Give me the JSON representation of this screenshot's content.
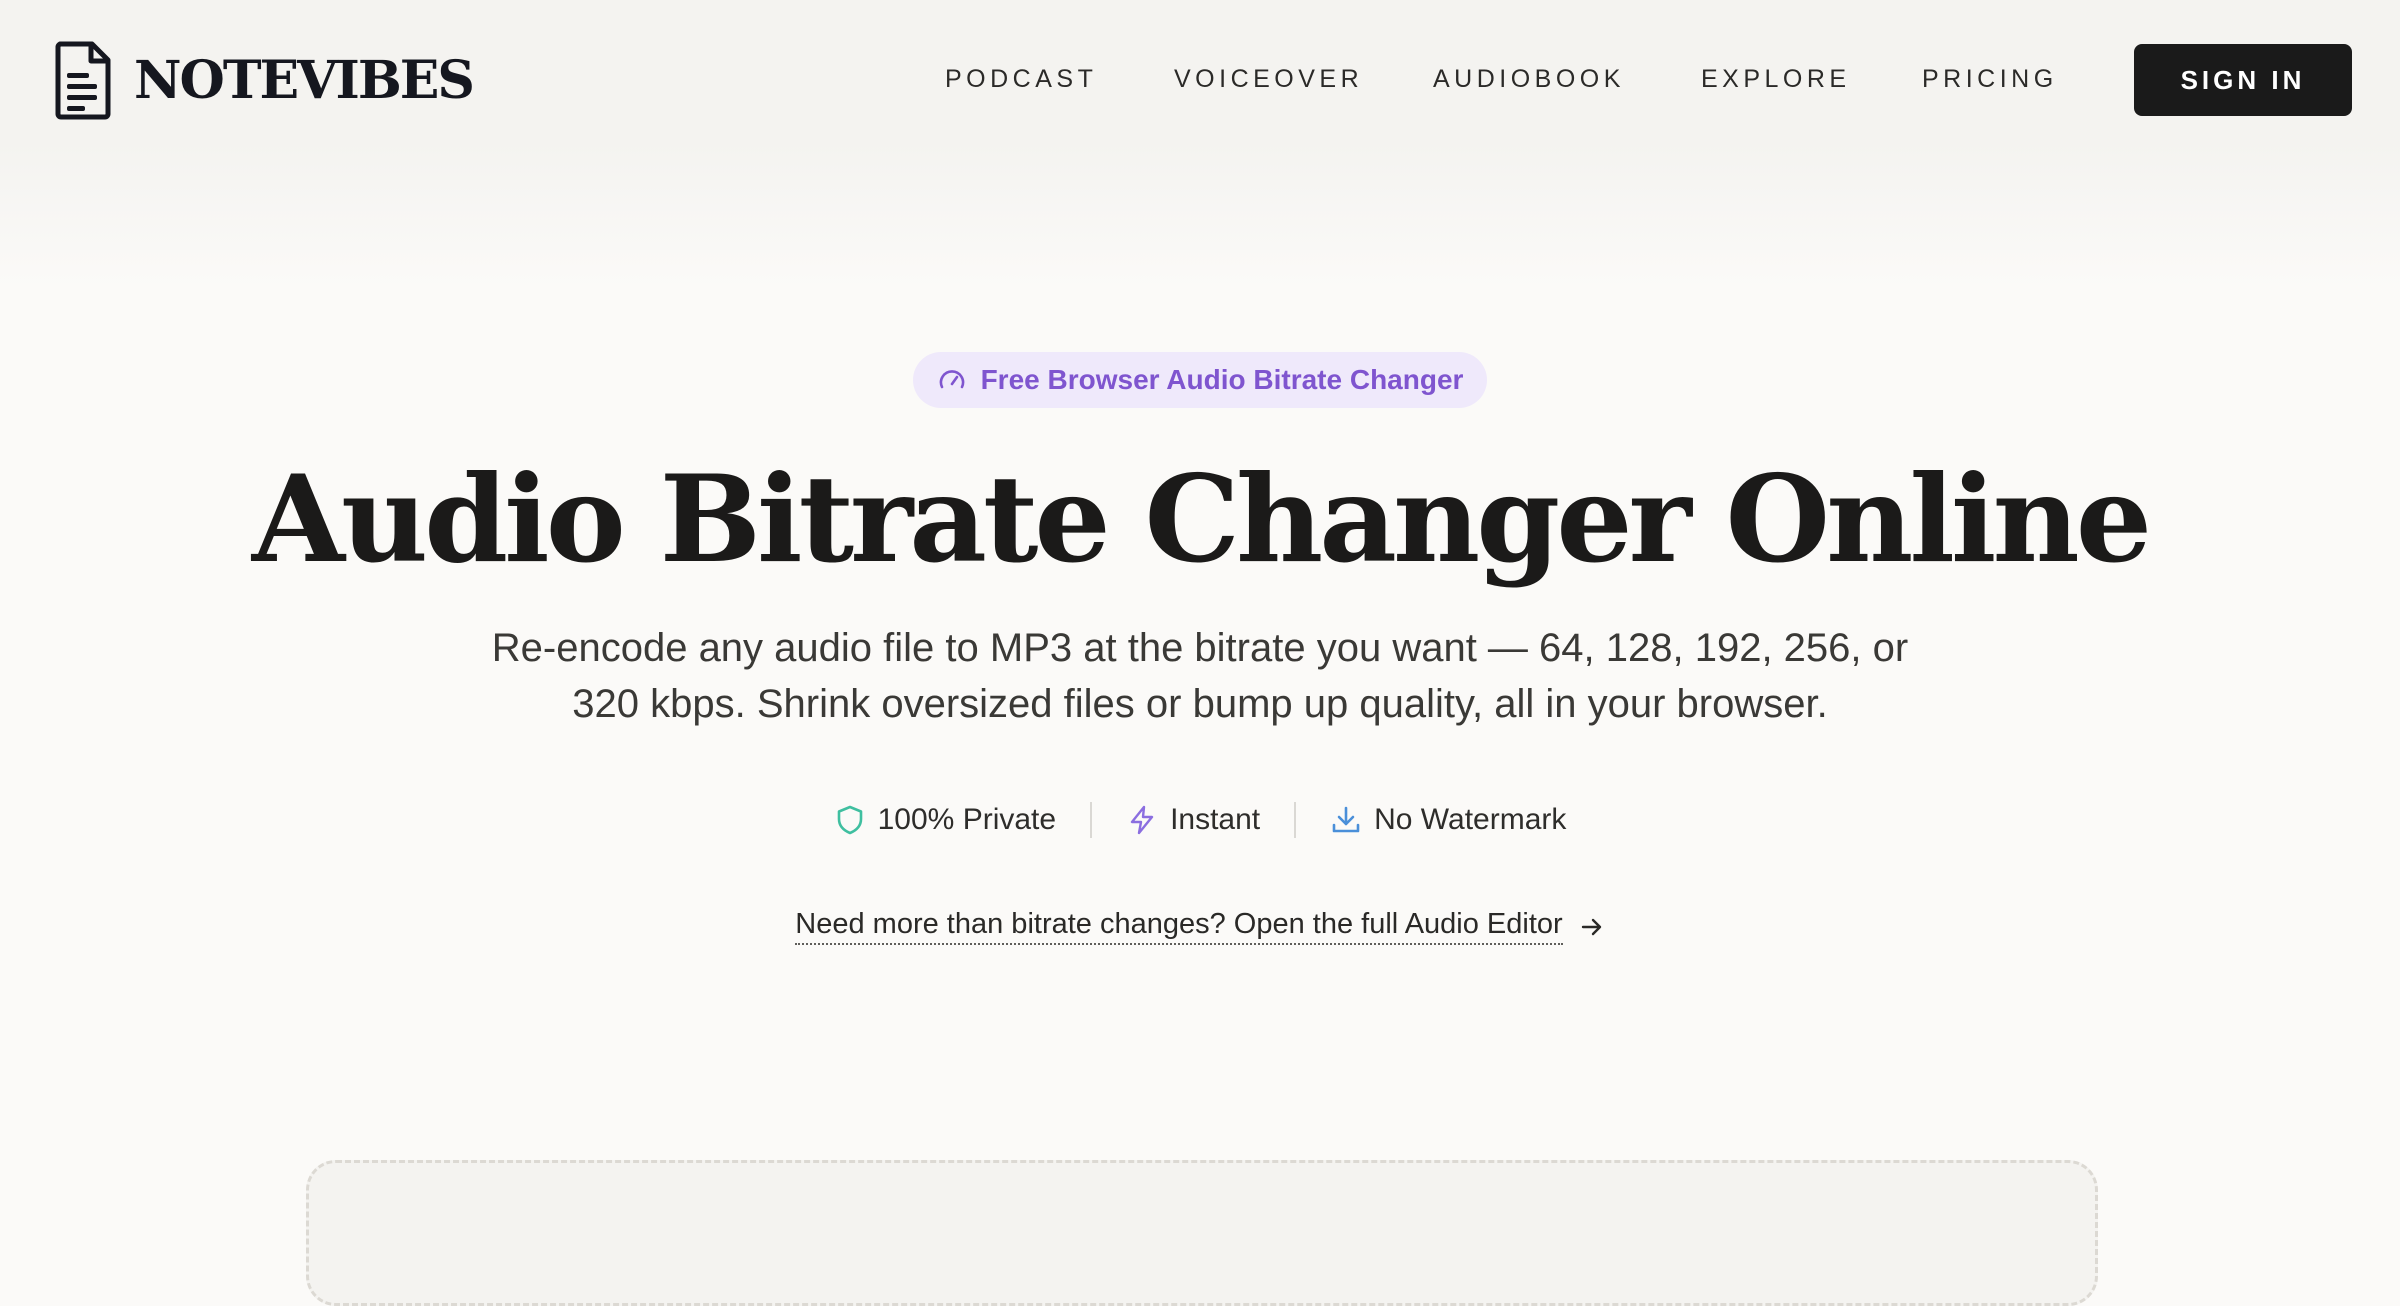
{
  "brand": {
    "name": "NOTEVIBES",
    "logo_icon": "document-icon"
  },
  "nav": {
    "items": [
      "PODCAST",
      "VOICEOVER",
      "AUDIOBOOK",
      "EXPLORE",
      "PRICING"
    ],
    "sign_in": "SIGN IN"
  },
  "hero": {
    "badge": {
      "icon": "gauge-icon",
      "text": "Free Browser Audio Bitrate Changer"
    },
    "title": "Audio Bitrate Changer Online",
    "subtitle_line1": "Re-encode any audio file to MP3 at the bitrate you want — 64, 128, 192, 256, or",
    "subtitle_line2": "320 kbps. Shrink oversized files or bump up quality, all in your browser.",
    "features": [
      {
        "icon": "shield-icon",
        "label": "100% Private",
        "color": "#3fbfa0"
      },
      {
        "icon": "lightning-icon",
        "label": "Instant",
        "color": "#8b6ee0"
      },
      {
        "icon": "download-icon",
        "label": "No Watermark",
        "color": "#4a8fd9"
      }
    ],
    "editor_link": "Need more than bitrate changes? Open the full Audio Editor"
  },
  "colors": {
    "accent": "#7f55cf",
    "badge_bg": "#efe9fb",
    "button_bg": "#1a1a1a",
    "page_bg": "#fbfaf8"
  }
}
